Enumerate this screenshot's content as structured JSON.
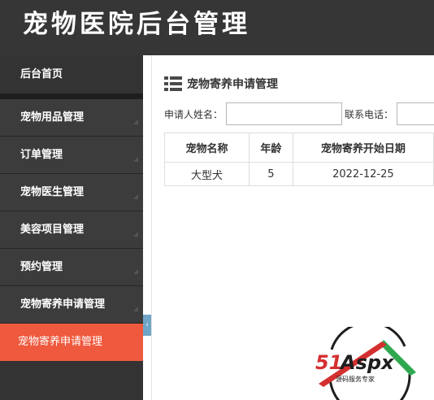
{
  "app": {
    "title": "宠物医院后台管理"
  },
  "sidebar": {
    "items": [
      {
        "label": "后台首页"
      },
      {
        "label": "宠物用品管理"
      },
      {
        "label": "订单管理"
      },
      {
        "label": "宠物医生管理"
      },
      {
        "label": "美容项目管理"
      },
      {
        "label": "预约管理"
      },
      {
        "label": "宠物寄养申请管理"
      },
      {
        "label": "宠物寄养申请管理"
      }
    ],
    "collapse_glyph": "‹"
  },
  "main": {
    "section_title": "宠物寄养申请管理",
    "search": {
      "applicant_label": "申请人姓名：",
      "applicant_value": "",
      "phone_label": "联系电话：",
      "phone_value": ""
    },
    "table": {
      "columns": [
        "宠物名称",
        "年龄",
        "宠物寄养开始日期"
      ],
      "rows": [
        [
          "大型犬",
          "5",
          "2022-12-25"
        ]
      ]
    }
  },
  "watermark": {
    "brand": "51Aspx",
    "tagline": "源码服务专家"
  },
  "colors": {
    "header_bg": "#363636",
    "sidebar_bg": "#3c3c3c",
    "active_item": "#ef5a3f",
    "collapse_handle": "#6fa5c6"
  },
  "icons": {
    "section": "list-icon",
    "menu_arrow": "corner-arrow-icon"
  }
}
